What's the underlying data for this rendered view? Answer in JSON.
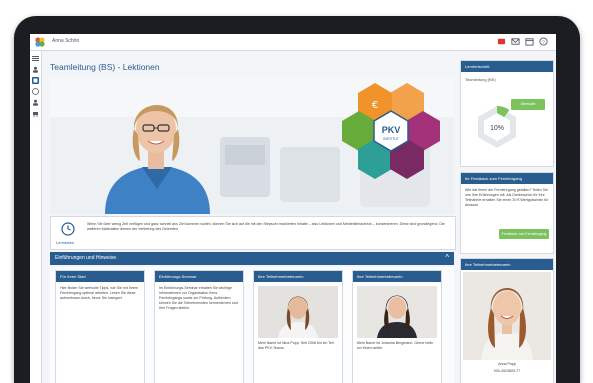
{
  "app": {
    "user_name": "Anna Schön"
  },
  "page": {
    "title": "Teamleitung (BS) - Lektionen"
  },
  "brand": {
    "logo_text": "PKV",
    "logo_sub": "INSTITUT"
  },
  "lecture": {
    "label": "Lerndaten",
    "text": "Wenn Sie über wenig Zeit verfügen und ganz schnell ans Ziel kommen wollen, können Sie sich auf die mit den Stepsuhr markierten Inhalte – also Lektionen und Medienliteracheck – konzentrieren. Diese sind grundlegend. Die weiteren Materialien dienen der Vertiefung des Gelernten."
  },
  "accordion": {
    "title": "Einführungen und Hinweise",
    "toggle": "^"
  },
  "cards": [
    {
      "header": "Für Ihren Start",
      "body": "Hier finden Sie wertvolle Tipps, wie Sie mit Ihrem Fernlehrgang optimal arbeiten. Lesen Sie diese aufmerksam durch, bevor Sie loslegen!"
    },
    {
      "header": "Einführungs-Seminar",
      "body": "Im Einführungs-Seminar erhalten Sie wichtige Informationen zur Organisation Ihres Fernlehrgangs sowie zur Prüfung. Außerdem können Sie die Teilnehmenden kennenlernen und Ihre Fragen stellen."
    },
    {
      "header": "Ihre Teilnehmerbetreuerin",
      "caption": "Mein Name ist Nina Popp. Seit 2008 bin ich Teil des PKV-Teams."
    },
    {
      "header": "Ihre Teilnehmerbetreuerin",
      "caption": "Mein Name ist Johanna Bergmann. Gerne helfe ich Ihnen weiter."
    }
  ],
  "side": {
    "progress": {
      "header": "Lernfortschritt",
      "subtitle": "Teamleitung (BS)",
      "button": "Übersicht",
      "percent_label": "10%",
      "percent": 0.1
    },
    "feedback": {
      "header": "Ihr Feedback zum Fernlehrgang",
      "text": "Wie hat Ihnen der Fernlehrgang gefallen? Teilen Sie uns Ihre Erfahrungen mit. Als Dankeschön für Ihre Teilnahme erhalten Sie einen 20 € Wertgutschein für Amazon.",
      "button": "Feedback zum Fernlehrgang"
    },
    "contact": {
      "header": "Ihre Teilnehmerbetreuerin",
      "name": "Anna Popp",
      "phone": "030-4923809-77"
    }
  },
  "colors": {
    "accent": "#2a5d8f",
    "green": "#7cc25e",
    "hex_orange": "#f0932b",
    "hex_green": "#67ab3a",
    "hex_magenta": "#a3327a",
    "hex_teal": "#2e9f97"
  }
}
